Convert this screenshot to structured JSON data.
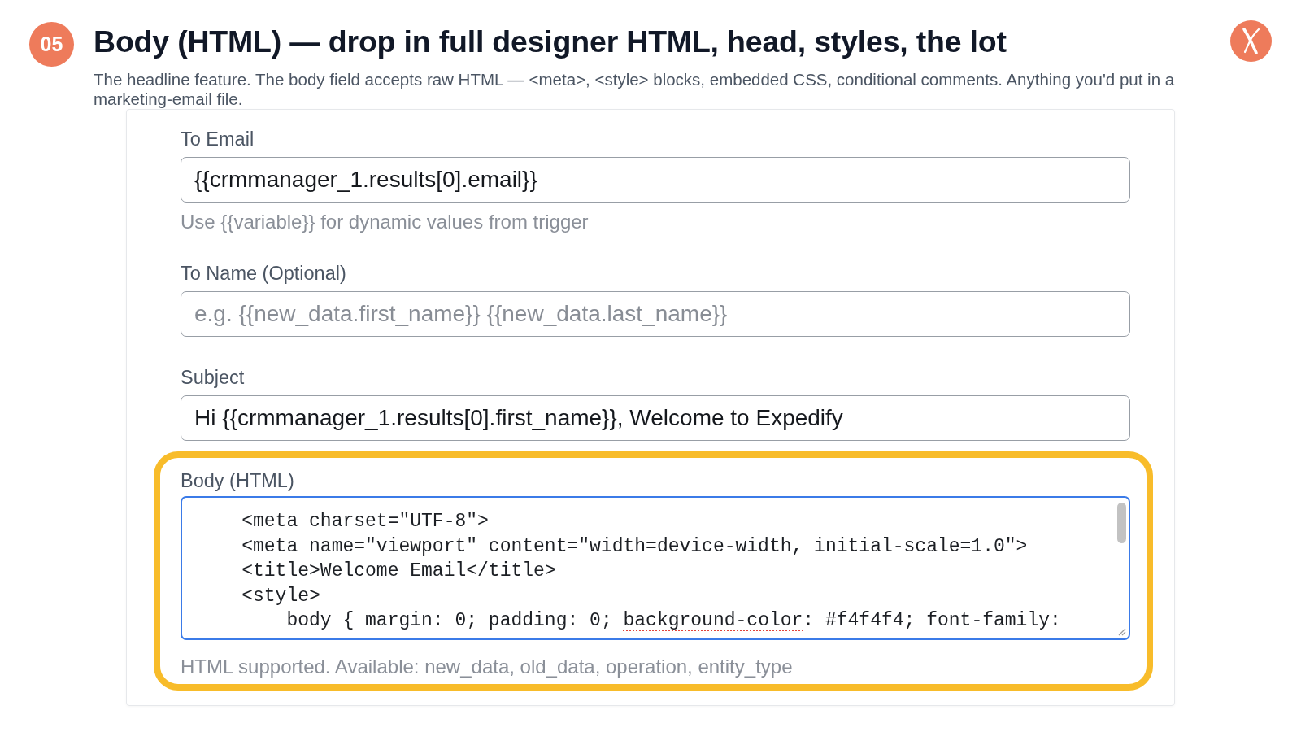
{
  "header": {
    "step": "05",
    "title": "Body (HTML) — drop in full designer HTML, head, styles, the lot",
    "description": "The headline feature. The body field accepts raw HTML — <meta>, <style> blocks, embedded CSS, conditional comments. Anything you'd put in a marketing-email file."
  },
  "form": {
    "fields": [
      {
        "kind": "input",
        "label": "To Email",
        "value": "{{crmmanager_1.results[0].email}}",
        "hint": "Use {{variable}} for dynamic values from trigger",
        "focused": false,
        "highlighted": false
      },
      {
        "kind": "input",
        "label": "To Name (Optional)",
        "placeholder": "e.g. {{new_data.first_name}} {{new_data.last_name}}",
        "focused": false,
        "highlighted": false
      },
      {
        "kind": "input",
        "label": "Subject",
        "value": "Hi {{crmmanager_1.results[0].first_name}}, Welcome to Expedify",
        "focused": false,
        "highlighted": false
      },
      {
        "kind": "code",
        "label": "Body (HTML)",
        "focused": true,
        "highlighted": true,
        "lines": [
          {
            "segments": [
              {
                "text": "    <meta charset=\"UTF-8\">",
                "misspelled": false
              }
            ]
          },
          {
            "segments": [
              {
                "text": "    <meta name=\"viewport\" content=\"width=device-width, initial-scale=1.0\">",
                "misspelled": false
              }
            ]
          },
          {
            "segments": [
              {
                "text": "    <title>Welcome Email</title>",
                "misspelled": false
              }
            ]
          },
          {
            "segments": [
              {
                "text": "    <style>",
                "misspelled": false
              }
            ]
          },
          {
            "segments": [
              {
                "text": "        body { margin: 0; padding: 0; ",
                "misspelled": false
              },
              {
                "text": "background-color",
                "misspelled": true
              },
              {
                "text": ": #f4f4f4; font-family:",
                "misspelled": false
              }
            ]
          }
        ],
        "hint": "HTML supported. Available: new_data, old_data, operation, entity_type"
      }
    ]
  }
}
